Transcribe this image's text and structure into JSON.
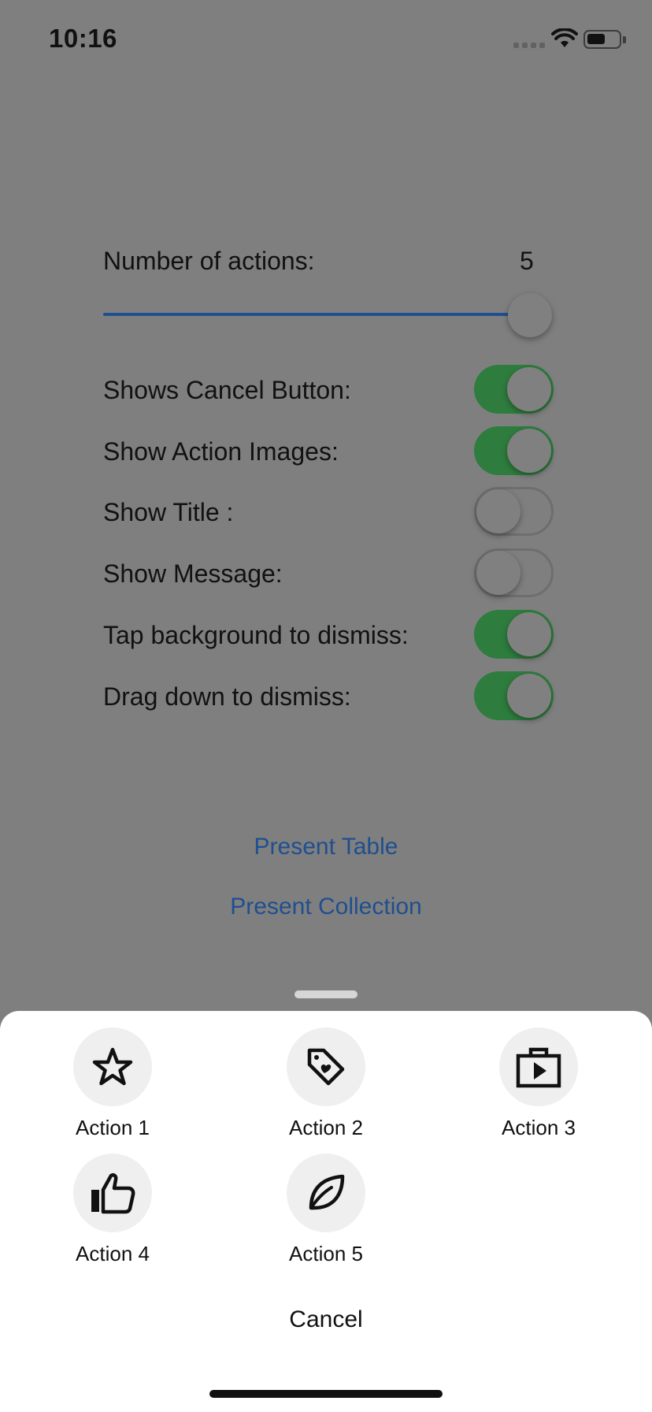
{
  "status_bar": {
    "time": "10:16"
  },
  "settings": {
    "actions_label": "Number of actions:",
    "actions_value": "5",
    "slider": {
      "min": 1,
      "max": 5,
      "value": 5
    },
    "toggles": [
      {
        "label": "Shows Cancel Button:",
        "on": true
      },
      {
        "label": "Show Action Images:",
        "on": true
      },
      {
        "label": "Show Title :",
        "on": false
      },
      {
        "label": "Show Message:",
        "on": false
      },
      {
        "label": "Tap background to dismiss:",
        "on": true
      },
      {
        "label": "Drag down to dismiss:",
        "on": true
      }
    ],
    "present_table": "Present Table",
    "present_collection": "Present Collection"
  },
  "sheet": {
    "actions": [
      {
        "label": "Action 1",
        "icon": "star-icon"
      },
      {
        "label": "Action 2",
        "icon": "tag-heart-icon"
      },
      {
        "label": "Action 3",
        "icon": "shopping-bag-play-icon"
      },
      {
        "label": "Action 4",
        "icon": "thumbs-up-icon"
      },
      {
        "label": "Action 5",
        "icon": "leaf-icon"
      }
    ],
    "cancel": "Cancel"
  },
  "colors": {
    "toggle_on": "#2e7d3e",
    "link": "#1f4f8f",
    "overlay": "#7f7f7f"
  }
}
